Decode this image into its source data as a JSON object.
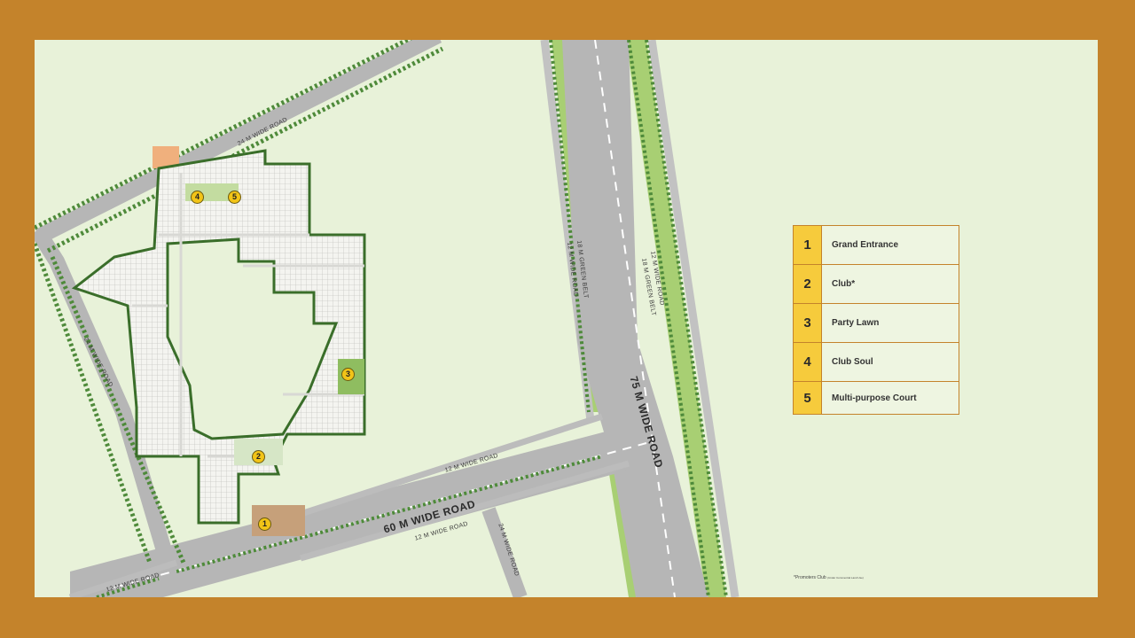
{
  "roads": {
    "road_24m_top": "24 M WIDE ROAD",
    "road_24m_left": "24 M WIDE ROAD",
    "road_60m": "60 M WIDE ROAD",
    "road_75m": "75 M WIDE ROAD",
    "road_12m_north": "12 M WIDE ROAD",
    "road_12m_south": "12 M WIDE ROAD",
    "road_12m_southwest": "12 M WIDE ROAD",
    "road_24m_bottom": "24 M WIDE ROAD",
    "green_belt_left": "18 M GREEN BELT",
    "service_road_left": "12 M WIDE ROAD",
    "green_belt_right": "18 M GREEN BELT",
    "service_road_right": "12 M WIDE ROAD"
  },
  "markers": [
    "1",
    "2",
    "3",
    "4",
    "5"
  ],
  "legend": [
    {
      "num": "1",
      "label": "Grand Entrance"
    },
    {
      "num": "2",
      "label": "Club*"
    },
    {
      "num": "3",
      "label": "Party Lawn"
    },
    {
      "num": "4",
      "label": "Club Soul"
    },
    {
      "num": "5",
      "label": "Multi-purpose Court"
    }
  ],
  "footnote": {
    "main": "*Promoters Club",
    "fine": "(Under Commercial Land Use)"
  },
  "colors": {
    "frame": "#c4832b",
    "ground": "#e8f2d9",
    "road": "#b6b6b6",
    "tree": "#4e8a3a",
    "green_belt": "#a8cf73",
    "plot": "#f2f2ee",
    "commercial": "#f0b07d",
    "legend_accent": "#f6cb3c"
  }
}
